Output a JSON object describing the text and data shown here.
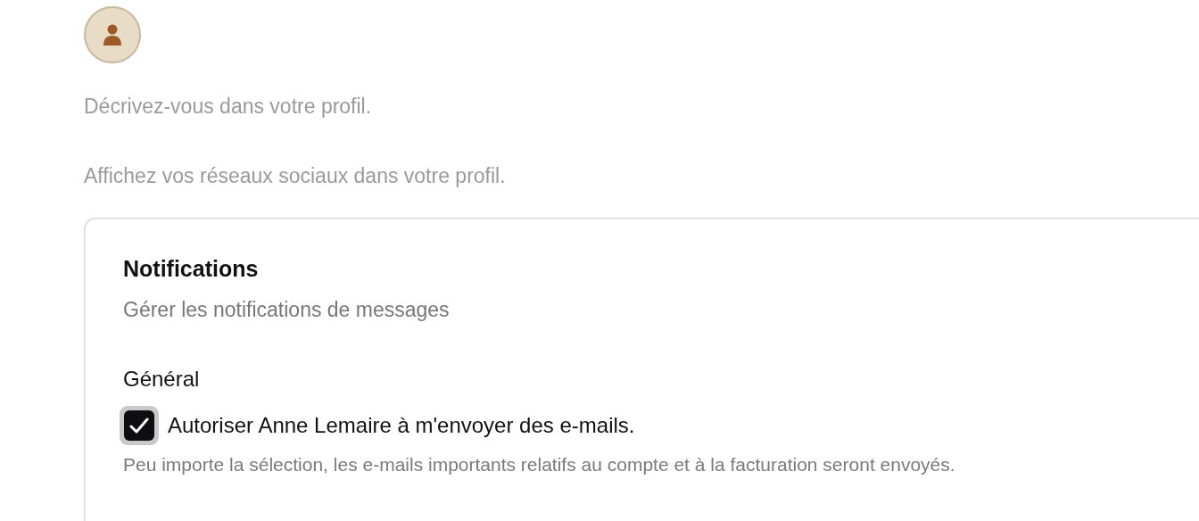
{
  "profile": {
    "bio_hint": "Décrivez-vous dans votre profil.",
    "social_hint": "Affichez vos réseaux sociaux dans votre profil."
  },
  "notifications": {
    "title": "Notifications",
    "subtitle": "Gérer les notifications de messages",
    "section": "Général",
    "options": [
      {
        "label": "Autoriser Anne Lemaire à m'envoyer des e-mails.",
        "checked": true,
        "hint": "Peu importe la sélection, les e-mails importants relatifs au compte et à la facturation seront envoyés."
      }
    ]
  }
}
